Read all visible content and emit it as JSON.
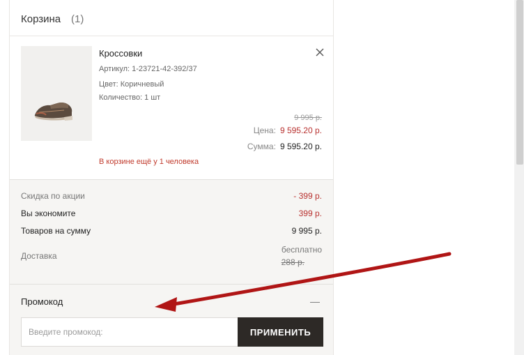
{
  "cart": {
    "title": "Корзина",
    "count": "(1)"
  },
  "item": {
    "name": "Кроссовки",
    "article": "Артикул: 1-23721-42-392/37",
    "color": "Цвет: Коричневый",
    "quantity": "Количество: 1 шт",
    "old_price": "9 995 р.",
    "price_label": "Цена:",
    "price": "9 595.20 р.",
    "sum_label": "Сумма:",
    "sum": "9 595.20 р.",
    "stock_note": "В корзине ещё у 1 человека",
    "remove_icon": "close-icon"
  },
  "summary": {
    "discount_label": "Скидка по акции",
    "discount_value": "- 399 р.",
    "savings_label": "Вы экономите",
    "savings_value": "399 р.",
    "total_label": "Товаров на сумму",
    "total_value": "9 995 р.",
    "delivery_label": "Доставка",
    "delivery_value": "бесплатно",
    "delivery_old": "288 р."
  },
  "promo": {
    "title": "Промокод",
    "toggle": "—",
    "placeholder": "Введите промокод:",
    "value": "",
    "button": "ПРИМЕНИТЬ"
  },
  "colors": {
    "accent_red": "#b8312f",
    "button_dark": "#2d2926",
    "arrow": "#b01515"
  }
}
